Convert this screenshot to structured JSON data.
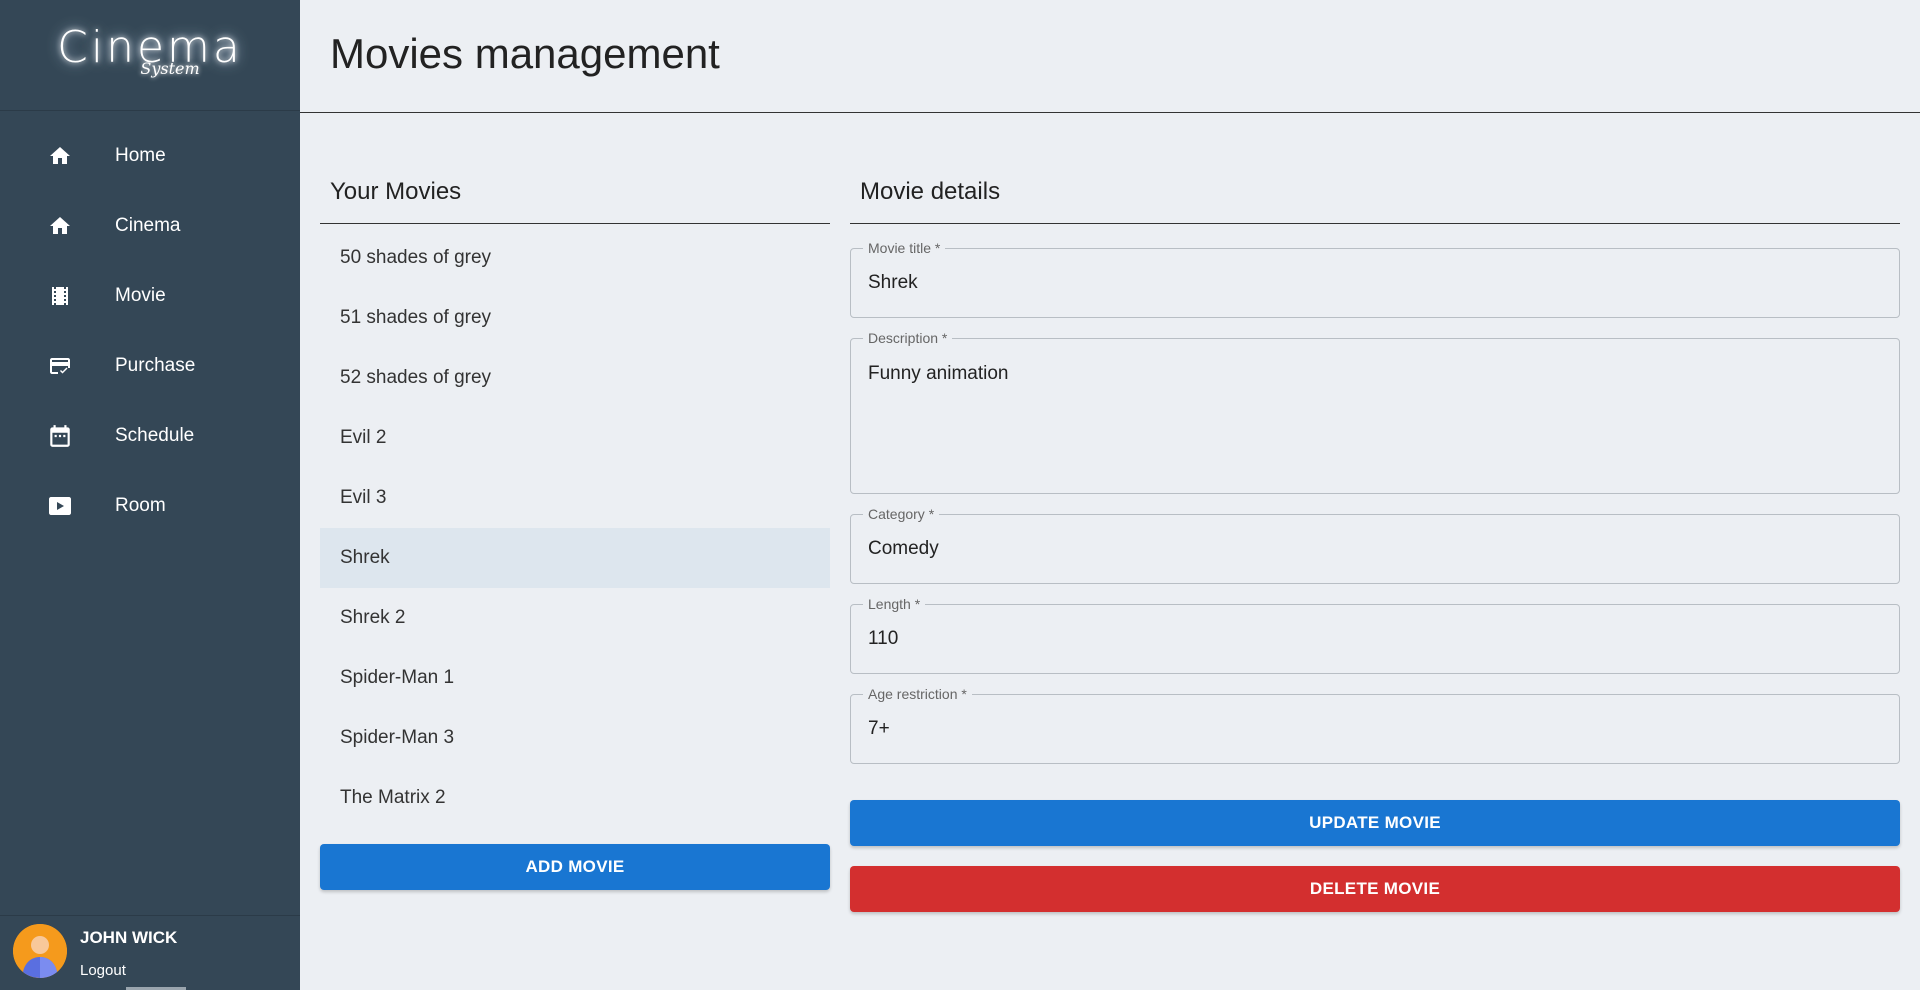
{
  "brand": {
    "name": "Cinema",
    "tagline": "System"
  },
  "nav": [
    {
      "label": "Home",
      "icon": "home-icon"
    },
    {
      "label": "Cinema",
      "icon": "home-icon"
    },
    {
      "label": "Movie",
      "icon": "film-icon"
    },
    {
      "label": "Purchase",
      "icon": "card-check-icon"
    },
    {
      "label": "Schedule",
      "icon": "calendar-icon"
    },
    {
      "label": "Room",
      "icon": "play-box-icon"
    }
  ],
  "user": {
    "name": "JOHN WICK",
    "logout_label": "Logout"
  },
  "page": {
    "title": "Movies management"
  },
  "movies": {
    "section_title": "Your Movies",
    "items": [
      "50 shades of grey",
      "51 shades of grey",
      "52 shades of grey",
      "Evil 2",
      "Evil 3",
      "Shrek",
      "Shrek 2",
      "Spider-Man 1",
      "Spider-Man 3",
      "The Matrix 2"
    ],
    "selected": "Shrek",
    "add_label": "ADD MOVIE"
  },
  "details": {
    "section_title": "Movie details",
    "fields": {
      "title": {
        "label": "Movie title *",
        "value": "Shrek"
      },
      "description": {
        "label": "Description *",
        "value": "Funny animation"
      },
      "category": {
        "label": "Category *",
        "value": "Comedy"
      },
      "length": {
        "label": "Length *",
        "value": "110"
      },
      "age": {
        "label": "Age restriction *",
        "value": "7+"
      }
    },
    "update_label": "UPDATE MOVIE",
    "delete_label": "DELETE MOVIE"
  },
  "colors": {
    "sidebar": "#344756",
    "primary": "#1976d2",
    "danger": "#d32f2f",
    "selected_row": "#dde6ee"
  }
}
